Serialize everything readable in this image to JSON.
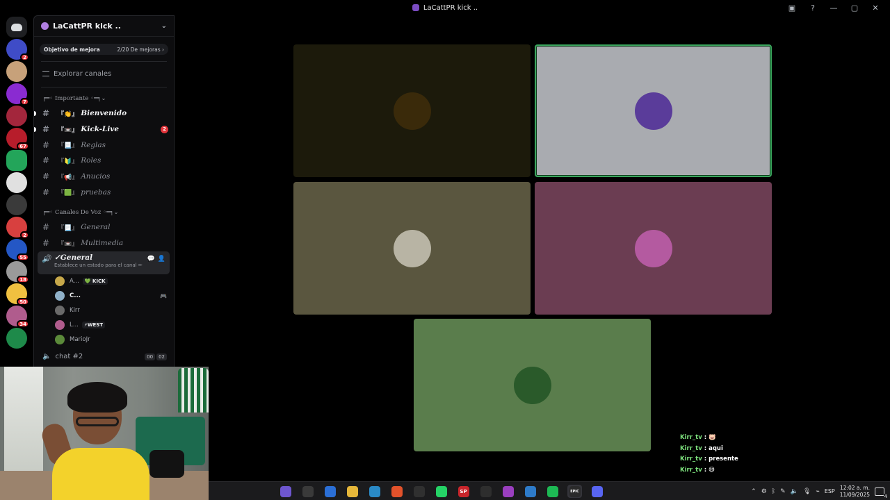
{
  "window": {
    "title": "LaCattPR kick ..",
    "controls": [
      "minimize",
      "maximize",
      "close"
    ]
  },
  "servers": [
    {
      "name": "server-1",
      "badge": "2",
      "color": "#3f4cc7"
    },
    {
      "name": "server-2",
      "badge": "",
      "color": "#c7a17a"
    },
    {
      "name": "server-3",
      "badge": "7",
      "color": "#8a2bd1"
    },
    {
      "name": "server-4",
      "badge": "",
      "color": "#a3263c"
    },
    {
      "name": "server-5",
      "badge": "67",
      "color": "#b71d2b"
    },
    {
      "name": "server-6",
      "badge": "",
      "color": "#23a55a"
    },
    {
      "name": "server-7",
      "badge": "",
      "color": "#e0e0e0"
    },
    {
      "name": "server-8",
      "badge": "",
      "color": "#3a3a3a"
    },
    {
      "name": "server-9",
      "badge": "2",
      "color": "#d8403f"
    },
    {
      "name": "server-10",
      "badge": "55",
      "color": "#2457c5"
    },
    {
      "name": "server-11",
      "badge": "18",
      "color": "#9a9a9a"
    },
    {
      "name": "server-12",
      "badge": "50",
      "color": "#f0c040"
    },
    {
      "name": "server-13",
      "badge": "34",
      "color": "#b05c8d"
    },
    {
      "name": "server-14",
      "badge": "",
      "color": "#1e8a4a"
    }
  ],
  "panel": {
    "server_name": "LaCattPR kick ..",
    "boost": {
      "label": "Objetivo de mejora",
      "progress": "2/20 De mejoras"
    },
    "explore": "Explorar canales",
    "categories": [
      {
        "name": "╒═◦ Importante ◦═╕",
        "channels": [
          {
            "prefix": "『👏』",
            "name": "Bienvenido",
            "unread": true,
            "count": ""
          },
          {
            "prefix": "『📼』",
            "name": "Kick-Live",
            "unread": true,
            "count": "2"
          },
          {
            "prefix": "『📃』",
            "name": "Reglas",
            "unread": false,
            "count": ""
          },
          {
            "prefix": "『🔰』",
            "name": "Roles",
            "unread": false,
            "count": ""
          },
          {
            "prefix": "『📢』",
            "name": "Anucios",
            "unread": false,
            "count": ""
          },
          {
            "prefix": "『🟩』",
            "name": "pruebas",
            "unread": false,
            "count": ""
          }
        ]
      },
      {
        "name": "╒═◦ Canales De Voz ◦═╕",
        "channels": [
          {
            "prefix": "『📃』",
            "name": "General",
            "unread": false,
            "count": ""
          },
          {
            "prefix": "『📼』",
            "name": "Multimedia",
            "unread": false,
            "count": ""
          }
        ]
      }
    ],
    "voice_active": {
      "name": "✓General",
      "status": "Establece un estado para el canal ✏"
    },
    "voice_users": [
      {
        "name": "A...",
        "tag": "💚 KICK",
        "extra": "",
        "color": "#c7a84a"
      },
      {
        "name": "C...",
        "tag": "",
        "extra": "🎮",
        "color": "#8fb0c8"
      },
      {
        "name": "Kirr",
        "tag": "",
        "extra": "",
        "color": "#6a6a6a"
      },
      {
        "name": "L...",
        "tag": "⚡WEST",
        "extra": "",
        "color": "#b05c8d"
      },
      {
        "name": "MarioJr",
        "tag": "",
        "extra": "",
        "color": "#5b8a3a"
      }
    ],
    "chat2": {
      "name": "chat #2",
      "pills": [
        "00",
        "02"
      ]
    }
  },
  "tiles": [
    {
      "name": "tile-1",
      "bg": "#1c1a0b",
      "avatar": "#3a2a0a",
      "speaking": false
    },
    {
      "name": "tile-2",
      "bg": "#a9abb0",
      "avatar": "#5a3c9a",
      "speaking": true
    },
    {
      "name": "tile-3",
      "bg": "#5a563f",
      "avatar": "#b8b4a4",
      "speaking": false
    },
    {
      "name": "tile-4",
      "bg": "#6b3d52",
      "avatar": "#b45aa0",
      "speaking": false
    },
    {
      "name": "tile-5",
      "bg": "#5a7d4c",
      "avatar": "#2a5a2a",
      "speaking": false
    }
  ],
  "stream_chat": [
    {
      "user": "Kirr_tv",
      "msg": "🐷"
    },
    {
      "user": "Kirr_tv",
      "msg": "aqui"
    },
    {
      "user": "Kirr_tv",
      "msg": "presente"
    },
    {
      "user": "Kirr_tv",
      "msg": "😅"
    }
  ],
  "taskbar": {
    "apps": [
      {
        "name": "copilot",
        "label": "",
        "color": "#6e56cf"
      },
      {
        "name": "app-2",
        "label": "",
        "color": "#3a3a3a"
      },
      {
        "name": "store",
        "label": "",
        "color": "#2b6fd6"
      },
      {
        "name": "explorer",
        "label": "",
        "color": "#e6b73a"
      },
      {
        "name": "app-5",
        "label": "",
        "color": "#2a8ac6"
      },
      {
        "name": "brave",
        "label": "",
        "color": "#e2522b"
      },
      {
        "name": "obs",
        "label": "",
        "color": "#303030"
      },
      {
        "name": "whatsapp",
        "label": "",
        "color": "#25d366"
      },
      {
        "name": "sp",
        "label": "SP",
        "color": "#c8252b"
      },
      {
        "name": "app-10",
        "label": "",
        "color": "#2e2e2e"
      },
      {
        "name": "app-11",
        "label": "",
        "color": "#9a3fbf"
      },
      {
        "name": "app-12",
        "label": "",
        "color": "#2e7bc9"
      },
      {
        "name": "spotify",
        "label": "",
        "color": "#1db954"
      },
      {
        "name": "epic",
        "label": "EPIC",
        "color": "#2a2a2a"
      },
      {
        "name": "discord",
        "label": "",
        "color": "#5865f2"
      }
    ],
    "lang": "ESP",
    "time": "12:02 a. m.",
    "date": "11/09/2025",
    "notifications": "4"
  }
}
